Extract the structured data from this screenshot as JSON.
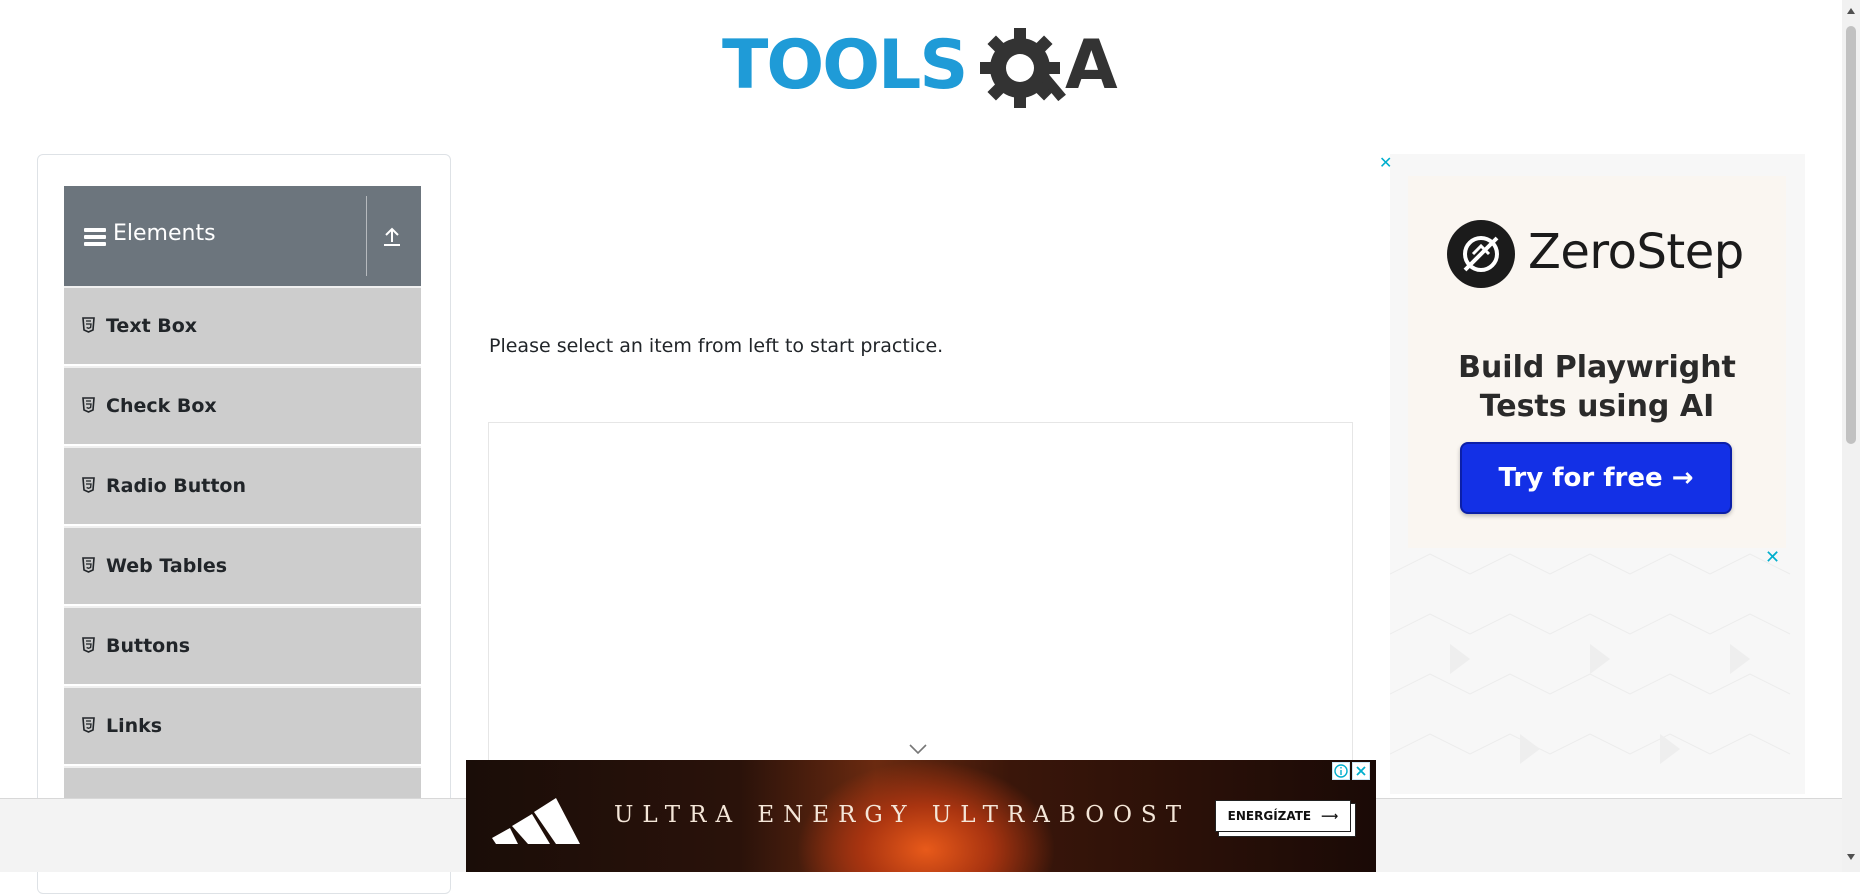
{
  "logo": {
    "text": "TOOLSQA",
    "accent": "#1f9bd7",
    "dark": "#333333"
  },
  "sidebar": {
    "group_title": "Elements",
    "items": [
      {
        "label": "Text Box"
      },
      {
        "label": "Check Box"
      },
      {
        "label": "Radio Button"
      },
      {
        "label": "Web Tables"
      },
      {
        "label": "Buttons"
      },
      {
        "label": "Links"
      },
      {
        "label": ""
      }
    ]
  },
  "main": {
    "practice_text": "Please select an item from left to start practice."
  },
  "right_ad": {
    "brand": "ZeroStep",
    "tagline_line1": "Build Playwright",
    "tagline_line2": "Tests using AI",
    "cta": "Try for free →",
    "close_label": "✕"
  },
  "bottom_ad": {
    "headline": "ULTRA ENERGY  ULTRABOOST",
    "cta": "ENERGÍZATE",
    "info_label": "ⓘ",
    "close_label": "✕"
  },
  "colors": {
    "sidebar_header": "#6c757d",
    "menu_item": "#cdcdcd",
    "cta_blue": "#1330e6",
    "ad_close": "#00aecd"
  }
}
